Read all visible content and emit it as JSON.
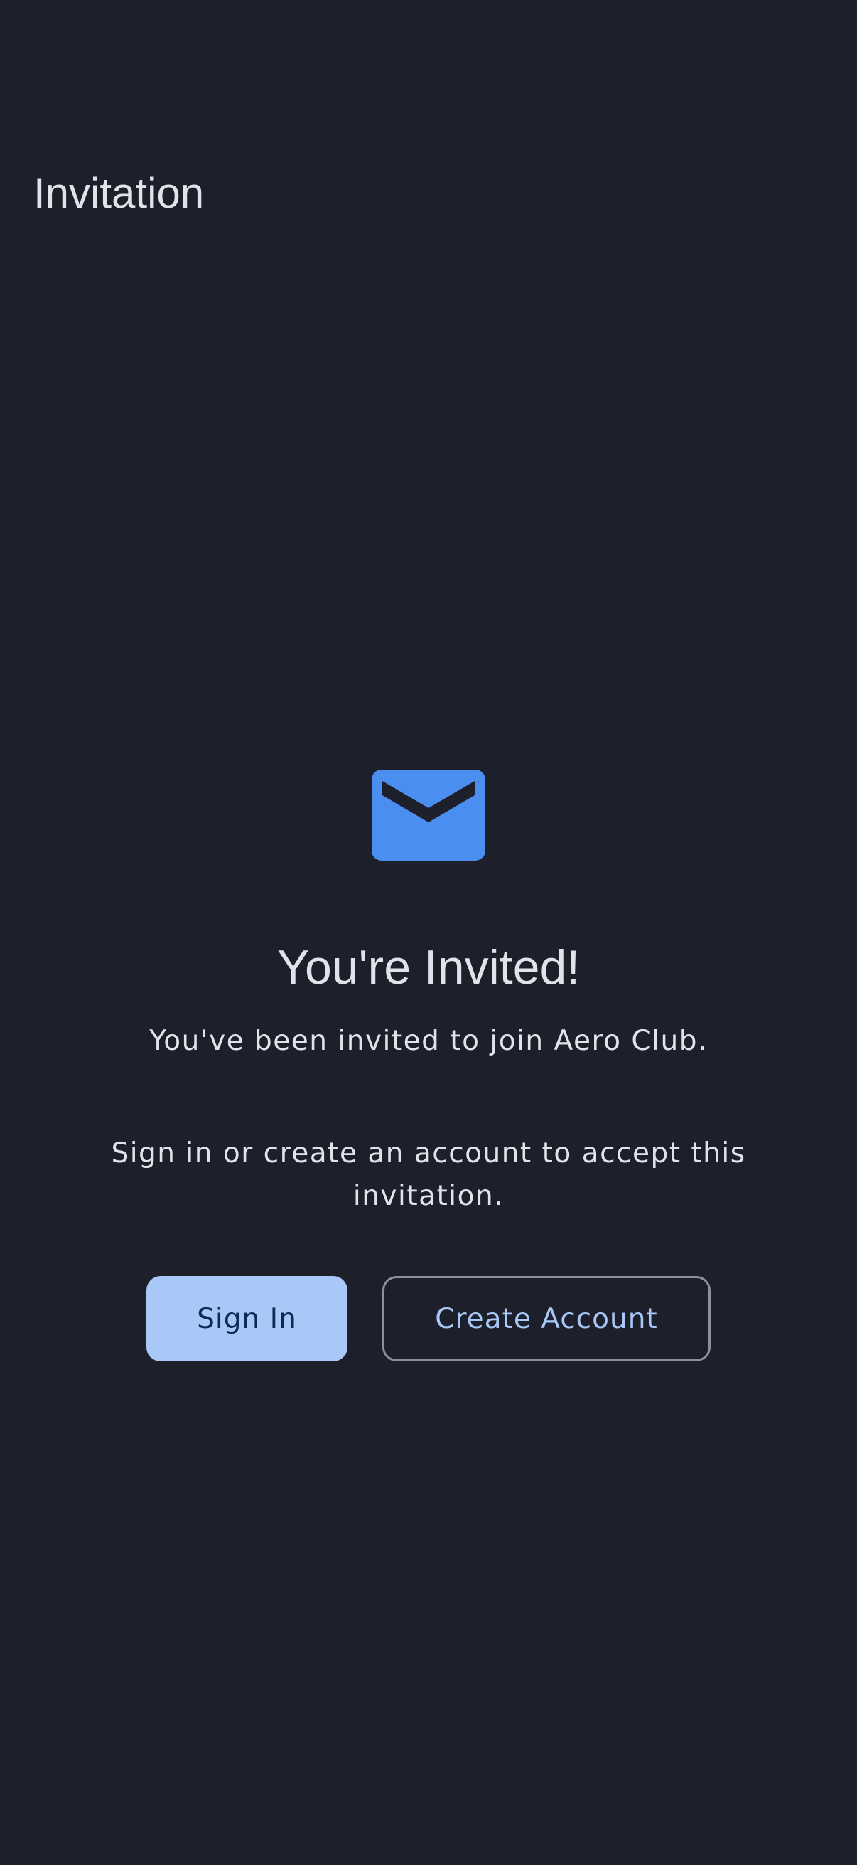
{
  "app_bar": {
    "title": "Invitation"
  },
  "invite": {
    "icon": "mail-icon",
    "headline": "You're Invited!",
    "subtitle": "You've been invited to join Aero Club.",
    "instruction": "Sign in or create an account to accept this invitation."
  },
  "actions": {
    "sign_in_label": "Sign In",
    "create_account_label": "Create Account"
  },
  "colors": {
    "background": "#1d202a",
    "primary_fill": "#a8c8f8",
    "icon_blue": "#4a8ef0",
    "text": "#e2e2ea",
    "outline": "#8e9099"
  }
}
